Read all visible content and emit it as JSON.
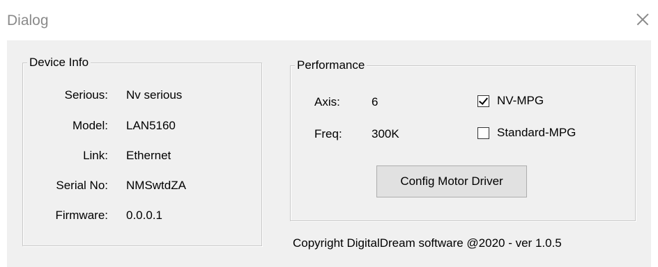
{
  "window": {
    "title": "Dialog",
    "close_icon": "close-icon"
  },
  "device_info": {
    "legend": "Device Info",
    "rows": [
      {
        "label": "Serious:",
        "value": "Nv serious"
      },
      {
        "label": "Model:",
        "value": "LAN5160"
      },
      {
        "label": "Link:",
        "value": "Ethernet"
      },
      {
        "label": "Serial No:",
        "value": "NMSwtdZA"
      },
      {
        "label": "Firmware:",
        "value": "0.0.0.1"
      }
    ]
  },
  "performance": {
    "legend": "Performance",
    "axis_label": "Axis:",
    "axis_value": "6",
    "freq_label": "Freq:",
    "freq_value": "300K",
    "nv_mpg": {
      "label": "NV-MPG",
      "checked": true
    },
    "standard_mpg": {
      "label": "Standard-MPG",
      "checked": false
    },
    "config_button": "Config Motor Driver"
  },
  "footer": {
    "copyright": "Copyright DigitalDream software @2020 - ver 1.0.5"
  }
}
